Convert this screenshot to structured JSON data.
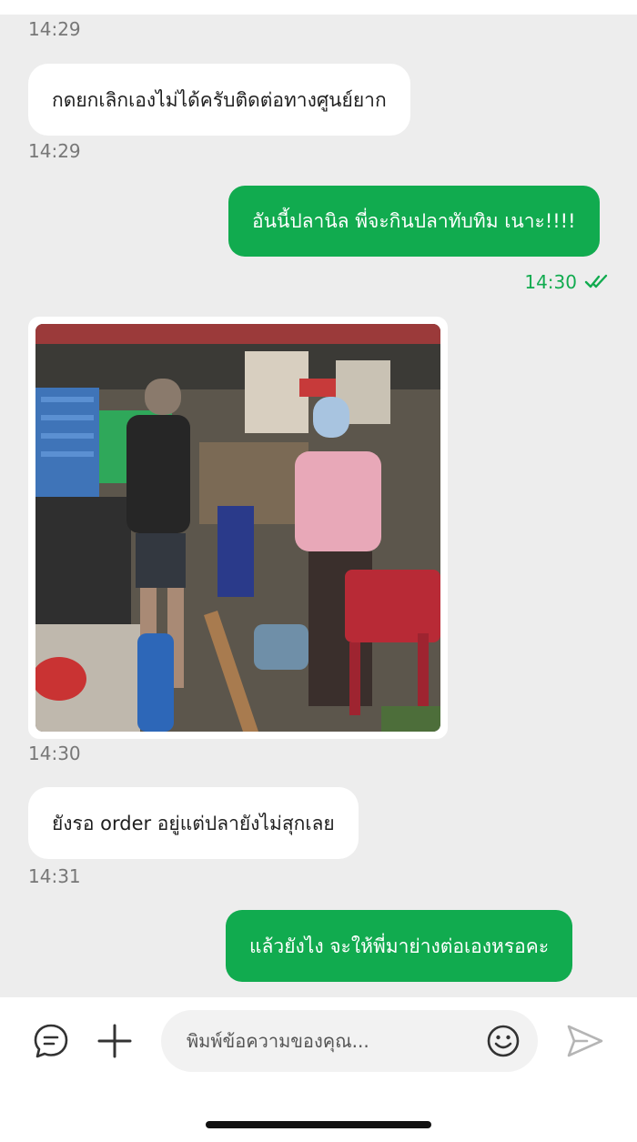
{
  "messages": [
    {
      "type": "timestamp",
      "time": "14:29"
    },
    {
      "type": "incoming",
      "text": "กดยกเลิกเองไม่ได้ครับติดต่อทางศูนย์ยาก",
      "time": "14:29"
    },
    {
      "type": "outgoing",
      "text": "อันนี้ปลานิล พี่จะกินปลาทับทิม เนาะ!!!!",
      "time": "14:30",
      "status": "read"
    },
    {
      "type": "incoming-photo",
      "time": "14:30"
    },
    {
      "type": "incoming",
      "text": "ยังรอ order อยู่แต่ปลายังไม่สุกเลย",
      "time": "14:31"
    },
    {
      "type": "outgoing",
      "text": "แล้วยังไง จะให้พี่มาย่างต่อเองหรอคะ"
    }
  ],
  "composer": {
    "placeholder": "พิมพ์ข้อความของคุณ..."
  },
  "colors": {
    "accent": "#11ab4f",
    "background": "#ededed",
    "incoming_bubble": "#ffffff",
    "timestamp": "#777777"
  },
  "icons": {
    "quick_reply": "chat-bubble-icon",
    "attach": "plus-icon",
    "emoji": "smiley-icon",
    "send": "send-icon",
    "read_receipt": "double-check-icon"
  }
}
